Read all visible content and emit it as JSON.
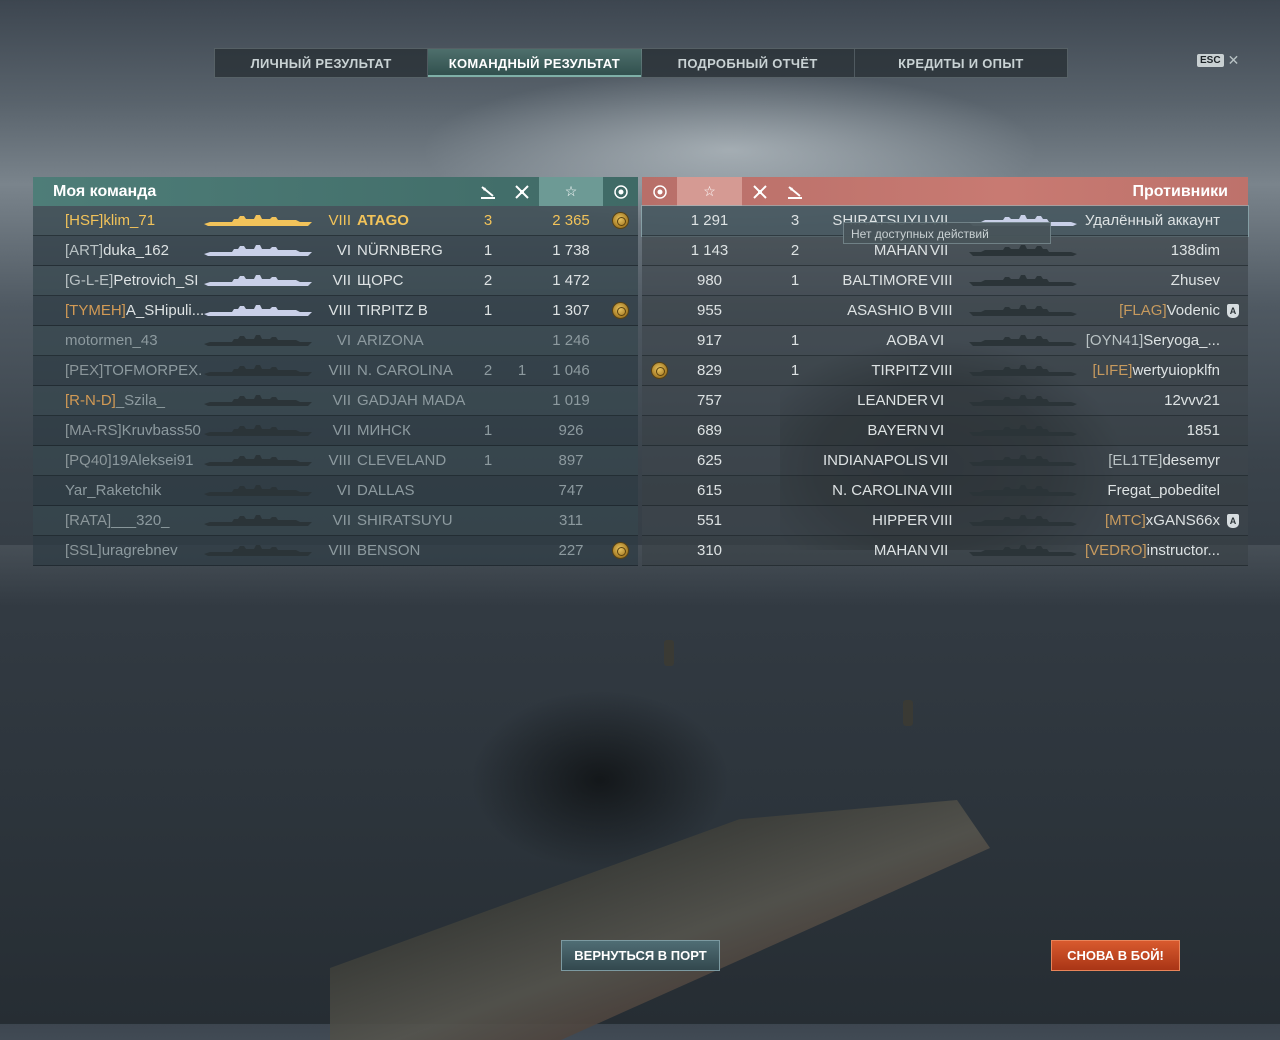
{
  "tabs": [
    {
      "label": "ЛИЧНЫЙ РЕЗУЛЬТАТ"
    },
    {
      "label": "КОМАНДНЫЙ РЕЗУЛЬТАТ"
    },
    {
      "label": "ПОДРОБНЫЙ ОТЧЁТ"
    },
    {
      "label": "КРЕДИТЫ И ОПЫТ"
    }
  ],
  "active_tab": "КОМАНДНЫЙ РЕЗУЛЬТАТ",
  "esc_label": "ESC",
  "my_team": {
    "title": "Моя команда",
    "players": [
      {
        "clan": "[HSF]",
        "name": "klim_71",
        "tier": "VIII",
        "ship": "ATAGO",
        "kills": "3",
        "planes": "",
        "xp": "2 365",
        "medal": true,
        "self": true
      },
      {
        "clan": "[ART]",
        "name": "duka_162",
        "tier": "VI",
        "ship": "NÜRNBERG",
        "kills": "1",
        "planes": "",
        "xp": "1 738"
      },
      {
        "clan": "[G-L-E]",
        "name": "Petrovich_SI",
        "tier": "VII",
        "ship": "ЩОРС",
        "kills": "2",
        "planes": "",
        "xp": "1 472"
      },
      {
        "clan": "[TYMEH]",
        "name": "A_SHipuli...",
        "tier": "VIII",
        "ship": "TIRPITZ B",
        "kills": "1",
        "planes": "",
        "xp": "1 307",
        "medal": true,
        "gold_clan": true
      },
      {
        "clan": "",
        "name": "motormen_43",
        "tier": "VI",
        "ship": "ARIZONA",
        "kills": "",
        "planes": "",
        "xp": "1 246",
        "dead": true
      },
      {
        "clan": "[PEX]",
        "name": "TOFMORPEX...",
        "tier": "VIII",
        "ship": "N. CAROLINA",
        "kills": "2",
        "planes": "1",
        "xp": "1 046",
        "dead": true
      },
      {
        "clan": "[R-N-D]",
        "name": "_Szila_",
        "tier": "VII",
        "ship": "GADJAH MADA",
        "kills": "",
        "planes": "",
        "xp": "1 019",
        "dead": true,
        "gold_clan": true
      },
      {
        "clan": "[MA-RS]",
        "name": "Kruvbass50",
        "tier": "VII",
        "ship": "МИНСК",
        "kills": "1",
        "planes": "",
        "xp": "926",
        "dead": true
      },
      {
        "clan": "[PQ40]",
        "name": "19Aleksei91",
        "tier": "VIII",
        "ship": "CLEVELAND",
        "kills": "1",
        "planes": "",
        "xp": "897",
        "dead": true
      },
      {
        "clan": "",
        "name": "Yar_Raketchik",
        "tier": "VI",
        "ship": "DALLAS",
        "kills": "",
        "planes": "",
        "xp": "747",
        "dead": true
      },
      {
        "clan": "[RATA]",
        "name": "___320_",
        "tier": "VII",
        "ship": "SHIRATSUYU",
        "kills": "",
        "planes": "",
        "xp": "311",
        "dead": true
      },
      {
        "clan": "[SSL]",
        "name": "uragrebnev",
        "tier": "VIII",
        "ship": "BENSON",
        "kills": "",
        "planes": "",
        "xp": "227",
        "medal": true,
        "dead": true
      }
    ]
  },
  "enemies": {
    "title": "Противники",
    "players": [
      {
        "xp": "1 291",
        "kills": "3",
        "planes": "",
        "ship": "SHIRATSUYU",
        "tier": "VII",
        "clan": "",
        "name": "Удалённый аккаунт",
        "highlight": true
      },
      {
        "xp": "1 143",
        "kills": "2",
        "planes": "",
        "ship": "MAHAN",
        "tier": "VII",
        "clan": "",
        "name": "138dim"
      },
      {
        "xp": "980",
        "kills": "1",
        "planes": "",
        "ship": "BALTIMORE",
        "tier": "VIII",
        "clan": "",
        "name": "Zhusev"
      },
      {
        "xp": "955",
        "kills": "",
        "planes": "",
        "ship": "ASASHIO B",
        "tier": "VIII",
        "clan": "[FLAG]",
        "name": "Vodenic",
        "badge": true
      },
      {
        "xp": "917",
        "kills": "1",
        "planes": "",
        "ship": "AOBA",
        "tier": "VI",
        "clan": "[OYN41]",
        "name": "Seryoga_...",
        "plain_clan": true
      },
      {
        "xp": "829",
        "kills": "1",
        "planes": "",
        "ship": "TIRPITZ",
        "tier": "VIII",
        "clan": "[LIFE]",
        "name": "wertyuiopklfn",
        "medal": true
      },
      {
        "xp": "757",
        "kills": "",
        "planes": "",
        "ship": "LEANDER",
        "tier": "VI",
        "clan": "",
        "name": "12vvv21"
      },
      {
        "xp": "689",
        "kills": "",
        "planes": "",
        "ship": "BAYERN",
        "tier": "VI",
        "clan": "",
        "name": "1851"
      },
      {
        "xp": "625",
        "kills": "",
        "planes": "",
        "ship": "INDIANAPOLIS",
        "tier": "VII",
        "clan": "[EL1TE]",
        "name": "desemyr",
        "plain_clan": true
      },
      {
        "xp": "615",
        "kills": "",
        "planes": "",
        "ship": "N. CAROLINA",
        "tier": "VIII",
        "clan": "",
        "name": "Fregat_pobeditel"
      },
      {
        "xp": "551",
        "kills": "",
        "planes": "",
        "ship": "HIPPER",
        "tier": "VIII",
        "clan": "[MTC]",
        "name": "xGANS66x",
        "badge": true
      },
      {
        "xp": "310",
        "kills": "",
        "planes": "",
        "ship": "MAHAN",
        "tier": "VII",
        "clan": "[VEDRO]",
        "name": "instructor..."
      }
    ]
  },
  "tooltip": "Нет доступных действий",
  "buttons": {
    "port": "ВЕРНУТЬСЯ В ПОРТ",
    "battle": "СНОВА В БОЙ!"
  },
  "colors": {
    "team": "#4e7d78",
    "enemy": "#c87a72",
    "self_name": "#f2c35a",
    "battle_button": "#d85a2e"
  }
}
